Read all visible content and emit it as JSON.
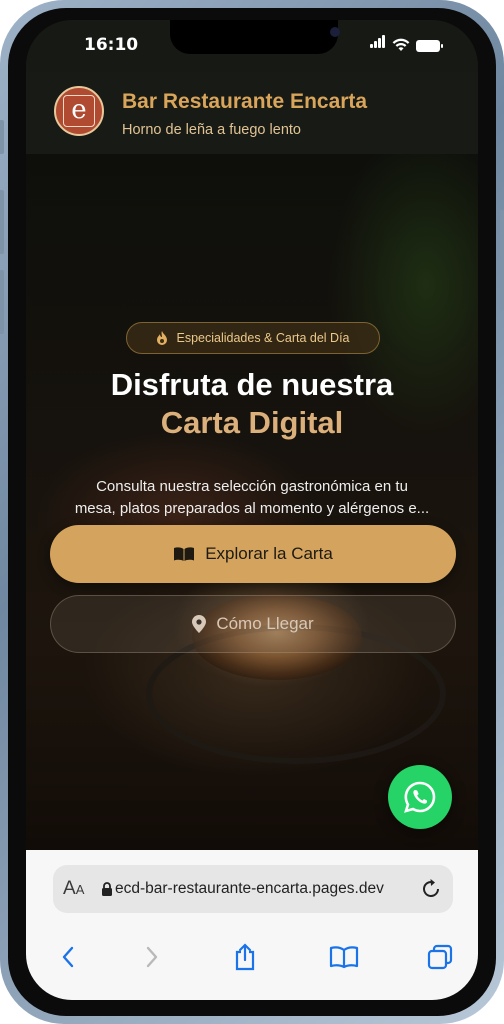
{
  "status_bar": {
    "time": "16:10"
  },
  "header": {
    "logo_letter": "e",
    "title": "Bar Restaurante Encarta",
    "tagline": "Horno de leña a fuego lento"
  },
  "hero": {
    "badge": "Especialidades & Carta del Día",
    "headline_line1": "Disfruta de nuestra",
    "headline_line2": "Carta Digital",
    "description_line1": "Consulta nuestra selección gastronómica en tu",
    "description_line2": "mesa, platos preparados al momento y alérgenos e...",
    "primary_button": "Explorar la Carta",
    "secondary_button": "Cómo Llegar"
  },
  "browser": {
    "text_size_label_large": "A",
    "text_size_label_small": "A",
    "url": "ecd-bar-restaurante-encarta.pages.dev"
  },
  "colors": {
    "accent": "#d4a45e",
    "title_gold": "#d9a55a",
    "whatsapp": "#25d366",
    "logo_bg": "#b04b32"
  },
  "icons": {
    "badge": "flame-icon",
    "primary_button": "book-open-icon",
    "secondary_button": "map-pin-icon",
    "fab": "whatsapp-icon",
    "url_lock": "lock-icon",
    "url_reload": "reload-icon",
    "toolbar": [
      "back-icon",
      "forward-icon",
      "share-icon",
      "bookmarks-icon",
      "tabs-icon"
    ]
  }
}
